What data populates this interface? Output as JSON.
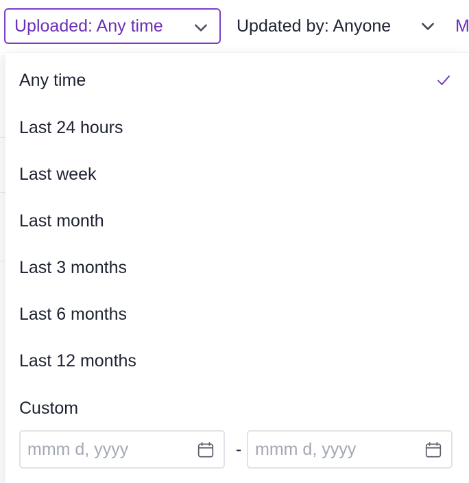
{
  "filters": {
    "uploaded": {
      "label": "Uploaded: Any time",
      "active": true
    },
    "updated_by": {
      "label": "Updated by: Anyone"
    },
    "more": {
      "label": "M"
    }
  },
  "dropdown": {
    "selected": "Any time",
    "options": [
      "Any time",
      "Last 24 hours",
      "Last week",
      "Last month",
      "Last 3 months",
      "Last 6 months",
      "Last 12 months"
    ],
    "custom": {
      "label": "Custom",
      "start_placeholder": "mmm d, yyyy",
      "end_placeholder": "mmm d, yyyy",
      "separator": "-"
    }
  },
  "icons": {
    "chevron": "chevron-down-icon",
    "check": "check-icon",
    "calendar": "calendar-icon"
  },
  "colors": {
    "accent": "#6b2fb8",
    "accent_border": "#7a3fc4",
    "text": "#1d2230",
    "placeholder": "#a3a8b3",
    "field_border": "#dfe2e8"
  }
}
